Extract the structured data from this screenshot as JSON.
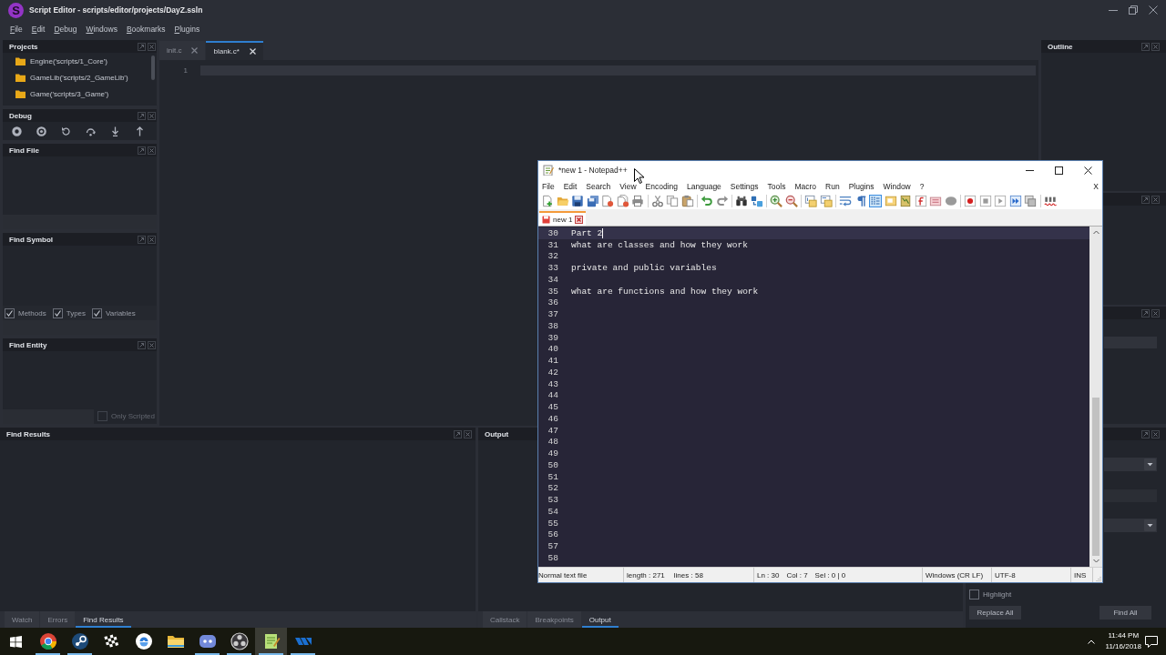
{
  "app": {
    "logo": "S",
    "title": "Script Editor - scripts/editor/projects/DayZ.ssln",
    "menu": [
      "File",
      "Edit",
      "Debug",
      "Windows",
      "Bookmarks",
      "Plugins"
    ]
  },
  "projects": {
    "title": "Projects",
    "items": [
      {
        "label": "Engine('scripts/1_Core')",
        "selected": false
      },
      {
        "label": "GameLib('scripts/2_GameLib')",
        "selected": false
      },
      {
        "label": "Game('scripts/3_Game')",
        "selected": false
      }
    ]
  },
  "debug": {
    "title": "Debug"
  },
  "find_file": {
    "title": "Find File"
  },
  "find_symbol": {
    "title": "Find Symbol",
    "filters": [
      {
        "label": "Methods",
        "checked": true
      },
      {
        "label": "Types",
        "checked": true
      },
      {
        "label": "Variables",
        "checked": true
      }
    ]
  },
  "find_entity": {
    "title": "Find Entity",
    "only_scripted": {
      "label": "Only Scripted",
      "checked": false,
      "disabled": true
    }
  },
  "editor": {
    "tabs": [
      {
        "label": "init.c",
        "selected": false
      },
      {
        "label": "blank.c*",
        "selected": true
      }
    ],
    "lines": [
      {
        "number": "1",
        "current": true
      }
    ]
  },
  "outline": {
    "title": "Outline"
  },
  "find_results": {
    "title": "Find Results",
    "dock_tabs": [
      {
        "label": "Watch",
        "selected": false
      },
      {
        "label": "Errors",
        "selected": false
      },
      {
        "label": "Find Results",
        "selected": true
      }
    ]
  },
  "output": {
    "title": "Output",
    "dock_tabs": [
      {
        "label": "Callstack",
        "selected": false
      },
      {
        "label": "Breakpoints",
        "selected": false
      },
      {
        "label": "Output",
        "selected": true
      }
    ]
  },
  "find_replace": {
    "highlight": {
      "label": "Highlight",
      "checked": false
    },
    "buttons": [
      "Replace All",
      "Find All"
    ]
  },
  "notepad": {
    "title": "*new 1 - Notepad++",
    "menu": [
      "File",
      "Edit",
      "Search",
      "View",
      "Encoding",
      "Language",
      "Settings",
      "Tools",
      "Macro",
      "Run",
      "Plugins",
      "Window",
      "?"
    ],
    "close_document": "X",
    "toolbar": [
      {
        "buttons": [
          {
            "kind": "new",
            "on": false
          },
          {
            "kind": "open",
            "on": false
          },
          {
            "kind": "save",
            "on": false
          },
          {
            "kind": "save_all",
            "on": false
          },
          {
            "kind": "close",
            "on": false
          },
          {
            "kind": "close_all",
            "on": false
          },
          {
            "kind": "print",
            "on": false
          }
        ]
      },
      {
        "buttons": [
          {
            "kind": "cut",
            "on": false
          },
          {
            "kind": "copy",
            "on": false
          },
          {
            "kind": "paste",
            "on": false
          }
        ]
      },
      {
        "buttons": [
          {
            "kind": "undo",
            "on": false
          },
          {
            "kind": "redo",
            "on": false
          }
        ]
      },
      {
        "buttons": [
          {
            "kind": "find",
            "on": false
          },
          {
            "kind": "replace",
            "on": false
          }
        ]
      },
      {
        "buttons": [
          {
            "kind": "zoom_in",
            "on": false
          },
          {
            "kind": "zoom_out",
            "on": false
          }
        ]
      },
      {
        "buttons": [
          {
            "kind": "sync_v",
            "on": false
          },
          {
            "kind": "sync_h",
            "on": false
          }
        ]
      },
      {
        "buttons": [
          {
            "kind": "wrap",
            "on": false
          },
          {
            "kind": "all_chars",
            "on": false
          },
          {
            "kind": "indent_guide",
            "on": true
          },
          {
            "kind": "udl",
            "on": false
          },
          {
            "kind": "doc_map",
            "on": false
          },
          {
            "kind": "func_list",
            "on": false
          },
          {
            "kind": "folder_ws",
            "on": false
          },
          {
            "kind": "monitor",
            "on": false
          }
        ]
      },
      {
        "buttons": [
          {
            "kind": "record",
            "on": false
          },
          {
            "kind": "stop",
            "on": false
          },
          {
            "kind": "play",
            "on": false
          },
          {
            "kind": "play_multi",
            "on": false
          },
          {
            "kind": "save_macro",
            "on": false
          }
        ]
      },
      {
        "buttons": [
          {
            "kind": "spell",
            "on": false
          }
        ]
      }
    ],
    "tabs": [
      {
        "label": "new 1",
        "selected": true,
        "modified": true
      }
    ],
    "lines": [
      {
        "number": "30",
        "text": "Part 2",
        "current": true
      },
      {
        "number": "31",
        "text": "what are classes and how they work",
        "current": false
      },
      {
        "number": "32",
        "current": false
      },
      {
        "number": "33",
        "text": "private and public variables",
        "current": false
      },
      {
        "number": "34",
        "current": false
      },
      {
        "number": "35",
        "text": "what are functions and how they work",
        "current": false
      },
      {
        "number": "36",
        "current": false
      },
      {
        "number": "37",
        "current": false
      },
      {
        "number": "38",
        "current": false
      },
      {
        "number": "39",
        "current": false
      },
      {
        "number": "40",
        "current": false
      },
      {
        "number": "41",
        "current": false
      },
      {
        "number": "42",
        "current": false
      },
      {
        "number": "43",
        "current": false
      },
      {
        "number": "44",
        "current": false
      },
      {
        "number": "45",
        "current": false
      },
      {
        "number": "46",
        "current": false
      },
      {
        "number": "47",
        "current": false
      },
      {
        "number": "48",
        "current": false
      },
      {
        "number": "49",
        "current": false
      },
      {
        "number": "50",
        "current": false
      },
      {
        "number": "51",
        "current": false
      },
      {
        "number": "52",
        "current": false
      },
      {
        "number": "53",
        "current": false
      },
      {
        "number": "54",
        "current": false
      },
      {
        "number": "55",
        "current": false
      },
      {
        "number": "56",
        "current": false
      },
      {
        "number": "57",
        "current": false
      },
      {
        "number": "58",
        "current": false
      }
    ],
    "status": {
      "file_type": "Normal text file",
      "length": "length : 271",
      "lines": "lines : 58",
      "line": "Ln : 30",
      "column": "Col : 7",
      "selection": "Sel : 0 | 0",
      "eol": "Windows (CR LF)",
      "encoding": "UTF-8",
      "mode": "INS"
    }
  },
  "taskbar": {
    "apps": [
      {
        "kind": "ring",
        "running": true,
        "selected": false
      },
      {
        "kind": "piston",
        "running": true,
        "selected": false
      },
      {
        "kind": "flag",
        "running": false,
        "selected": false
      },
      {
        "kind": "swirl",
        "running": false,
        "selected": false
      },
      {
        "kind": "folder",
        "running": false,
        "selected": false
      },
      {
        "kind": "controller",
        "running": true,
        "selected": false
      },
      {
        "kind": "aperture",
        "running": true,
        "selected": false
      },
      {
        "kind": "notepad",
        "running": true,
        "selected": true
      },
      {
        "kind": "stripes",
        "running": true,
        "selected": false
      }
    ],
    "time": "11:44 PM",
    "date": "11/16/2018"
  }
}
